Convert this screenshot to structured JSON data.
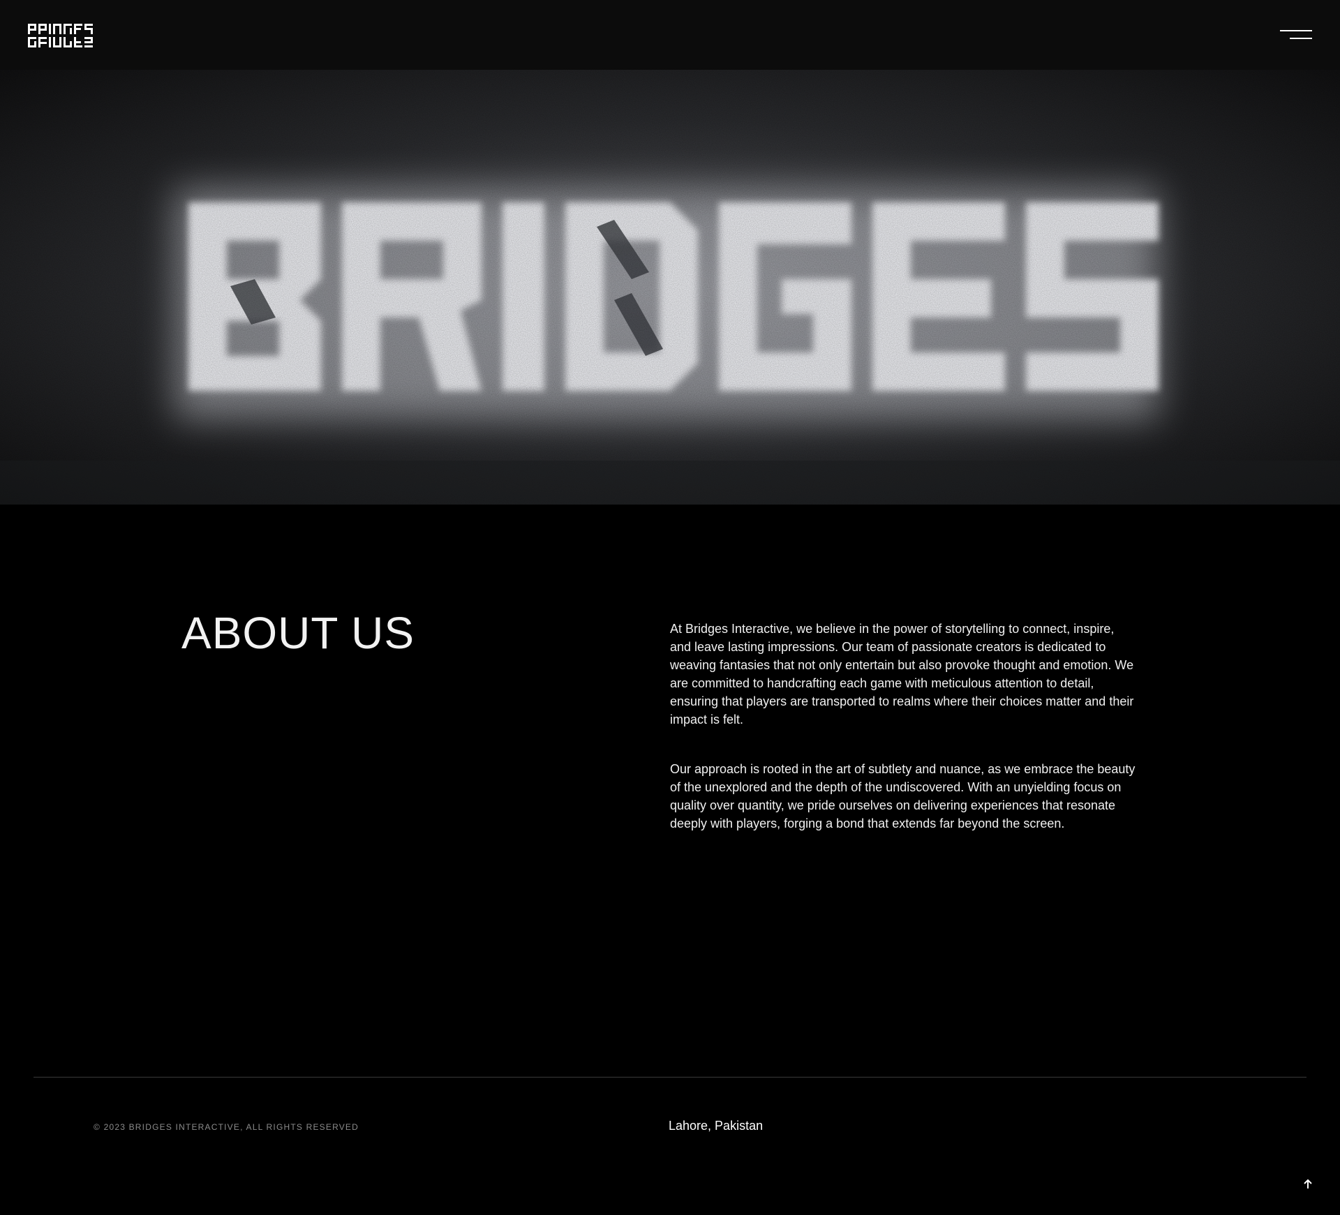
{
  "header": {
    "logo_alt": "BRIDGES",
    "menu_icon": "hamburger-menu-icon"
  },
  "hero": {
    "wordmark": "BRIDGES"
  },
  "about": {
    "title": "ABOUT US",
    "paragraphs": [
      "At Bridges Interactive, we believe in the power of storytelling to connect, inspire, and leave lasting impressions. Our team of passionate creators is dedicated to weaving fantasies that not only entertain but also provoke thought and emotion. We are committed to handcrafting each game with meticulous attention to detail, ensuring that players are transported to realms where their choices matter and their impact is felt.",
      "Our approach is rooted in the art of subtlety and nuance, as we embrace the beauty of the unexplored and the depth of the undiscovered. With an unyielding focus on quality over quantity, we pride ourselves on delivering experiences that resonate deeply with players, forging a bond that extends far beyond the screen."
    ]
  },
  "footer": {
    "copyright": "© 2023 BRIDGES INTERACTIVE, ALL RIGHTS RESERVED",
    "location": "Lahore, Pakistan",
    "back_to_top_icon": "arrow-up-icon"
  },
  "colors": {
    "background": "#000000",
    "header_background": "#0c0c0c",
    "text": "#ffffff",
    "muted_text": "#8b8b8b",
    "divider": "#3a3a3a"
  }
}
